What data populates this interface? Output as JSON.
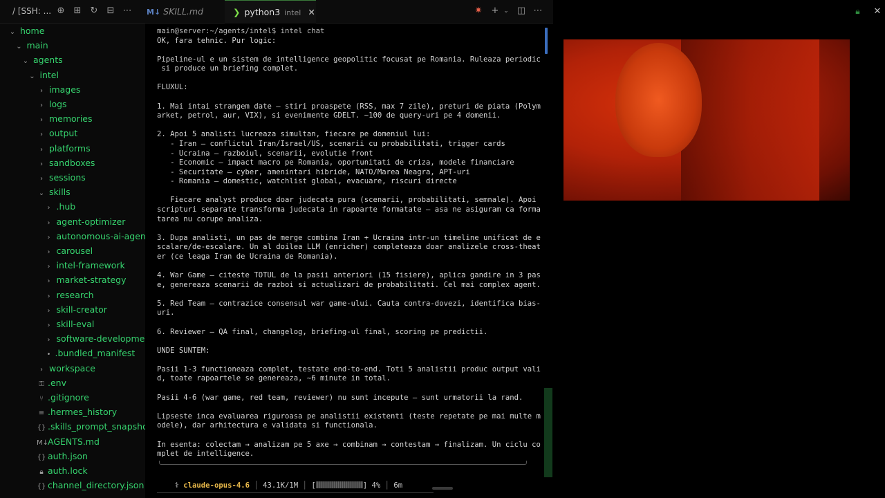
{
  "topbar": {
    "ssh_label": "/ [SSH: ...",
    "tabs": [
      {
        "label": "SKILL.md",
        "icon": "M↓"
      },
      {
        "label": "python3",
        "description": "intel"
      }
    ]
  },
  "sidebar": {
    "items": [
      {
        "label": "home",
        "indent": 0,
        "kind": "folder-open"
      },
      {
        "label": "main",
        "indent": 1,
        "kind": "folder-open"
      },
      {
        "label": "agents",
        "indent": 2,
        "kind": "folder-open"
      },
      {
        "label": "intel",
        "indent": 3,
        "kind": "folder-open"
      },
      {
        "label": "images",
        "indent": 4,
        "kind": "folder"
      },
      {
        "label": "logs",
        "indent": 4,
        "kind": "folder"
      },
      {
        "label": "memories",
        "indent": 4,
        "kind": "folder"
      },
      {
        "label": "output",
        "indent": 4,
        "kind": "folder"
      },
      {
        "label": "platforms",
        "indent": 4,
        "kind": "folder"
      },
      {
        "label": "sandboxes",
        "indent": 4,
        "kind": "folder"
      },
      {
        "label": "sessions",
        "indent": 4,
        "kind": "folder"
      },
      {
        "label": "skills",
        "indent": 4,
        "kind": "folder-open"
      },
      {
        "label": ".hub",
        "indent": 5,
        "kind": "folder"
      },
      {
        "label": "agent-optimizer",
        "indent": 5,
        "kind": "folder"
      },
      {
        "label": "autonomous-ai-agents",
        "indent": 5,
        "kind": "folder"
      },
      {
        "label": "carousel",
        "indent": 5,
        "kind": "folder"
      },
      {
        "label": "intel-framework",
        "indent": 5,
        "kind": "folder"
      },
      {
        "label": "market-strategy",
        "indent": 5,
        "kind": "folder"
      },
      {
        "label": "research",
        "indent": 5,
        "kind": "folder"
      },
      {
        "label": "skill-creator",
        "indent": 5,
        "kind": "folder"
      },
      {
        "label": "skill-eval",
        "indent": 5,
        "kind": "folder"
      },
      {
        "label": "software-development",
        "indent": 5,
        "kind": "folder"
      },
      {
        "label": ".bundled_manifest",
        "indent": 5,
        "kind": "dot"
      },
      {
        "label": "workspace",
        "indent": 4,
        "kind": "folder"
      },
      {
        "label": ".env",
        "indent": 4,
        "kind": "env"
      },
      {
        "label": ".gitignore",
        "indent": 4,
        "kind": "git"
      },
      {
        "label": ".hermes_history",
        "indent": 4,
        "kind": "file"
      },
      {
        "label": ".skills_prompt_snapsho...",
        "indent": 4,
        "kind": "json"
      },
      {
        "label": "AGENTS.md",
        "indent": 4,
        "kind": "md"
      },
      {
        "label": "auth.json",
        "indent": 4,
        "kind": "json"
      },
      {
        "label": "auth.lock",
        "indent": 4,
        "kind": "lock"
      },
      {
        "label": "channel_directory.json",
        "indent": 4,
        "kind": "json"
      }
    ]
  },
  "terminal": {
    "lines": [
      "main@server:~/agents/intel$ intel chat",
      "OK, fara tehnic. Pur logic:",
      "",
      "Pipeline-ul e un sistem de intelligence geopolitic focusat pe Romania. Ruleaza periodic",
      " si produce un briefing complet.",
      "",
      "FLUXUL:",
      "",
      "1. Mai intai strangem date — stiri proaspete (RSS, max 7 zile), preturi de piata (Polym",
      "arket, petrol, aur, VIX), si evenimente GDELT. ~100 de query-uri pe 4 domenii.",
      "",
      "2. Apoi 5 analisti lucreaza simultan, fiecare pe domeniul lui:",
      "   - Iran — conflictul Iran/Israel/US, scenarii cu probabilitati, trigger cards",
      "   - Ucraina — razboiul, scenarii, evolutie front",
      "   - Economic — impact macro pe Romania, oportunitati de criza, modele financiare",
      "   - Securitate — cyber, amenintari hibride, NATO/Marea Neagra, APT-uri",
      "   - Romania — domestic, watchlist global, evacuare, riscuri directe",
      "",
      "   Fiecare analyst produce doar judecata pura (scenarii, probabilitati, semnale). Apoi",
      "scripturi separate transforma judecata in rapoarte formatate — asa ne asiguram ca forma",
      "tarea nu corupe analiza.",
      "",
      "3. Dupa analisti, un pas de merge combina Iran + Ucraina intr-un timeline unificat de e",
      "scalare/de-escalare. Un al doilea LLM (enricher) completeaza doar analizele cross-theat",
      "er (ce leaga Iran de Ucraina de Romania).",
      "",
      "4. War Game — citeste TOTUL de la pasii anteriori (15 fisiere), aplica gandire in 3 pas",
      "e, genereaza scenarii de razboi si actualizari de probabilitati. Cel mai complex agent.",
      "",
      "5. Red Team — contrazice consensul war game-ului. Cauta contra-dovezi, identifica bias-",
      "uri.",
      "",
      "6. Reviewer — QA final, changelog, briefing-ul final, scoring pe predictii.",
      "",
      "UNDE SUNTEM:",
      "",
      "Pasii 1-3 functioneaza complet, testate end-to-end. Toti 5 analistii produc output vali",
      "d, toate rapoartele se genereaza, ~6 minute in total.",
      "",
      "Pasii 4-6 (war game, red team, reviewer) nu sunt incepute — sunt urmatorii la rand.",
      "",
      "Lipseste inca evaluarea riguroasa pe analistii existenti (teste repetate pe mai multe m",
      "odele), dar arhitectura e validata si functionala.",
      "",
      "In esenta: colectam → analizam pe 5 axe → combinam → contestam → finalizam. Un ciclu co",
      "mplet de intelligence."
    ],
    "status": {
      "branch_icon": "⚕",
      "model": "claude-opus-4.6",
      "tokens": "43.1K/1M",
      "percent": "4%",
      "context_fill": 0.04,
      "elapsed": "6m"
    }
  }
}
